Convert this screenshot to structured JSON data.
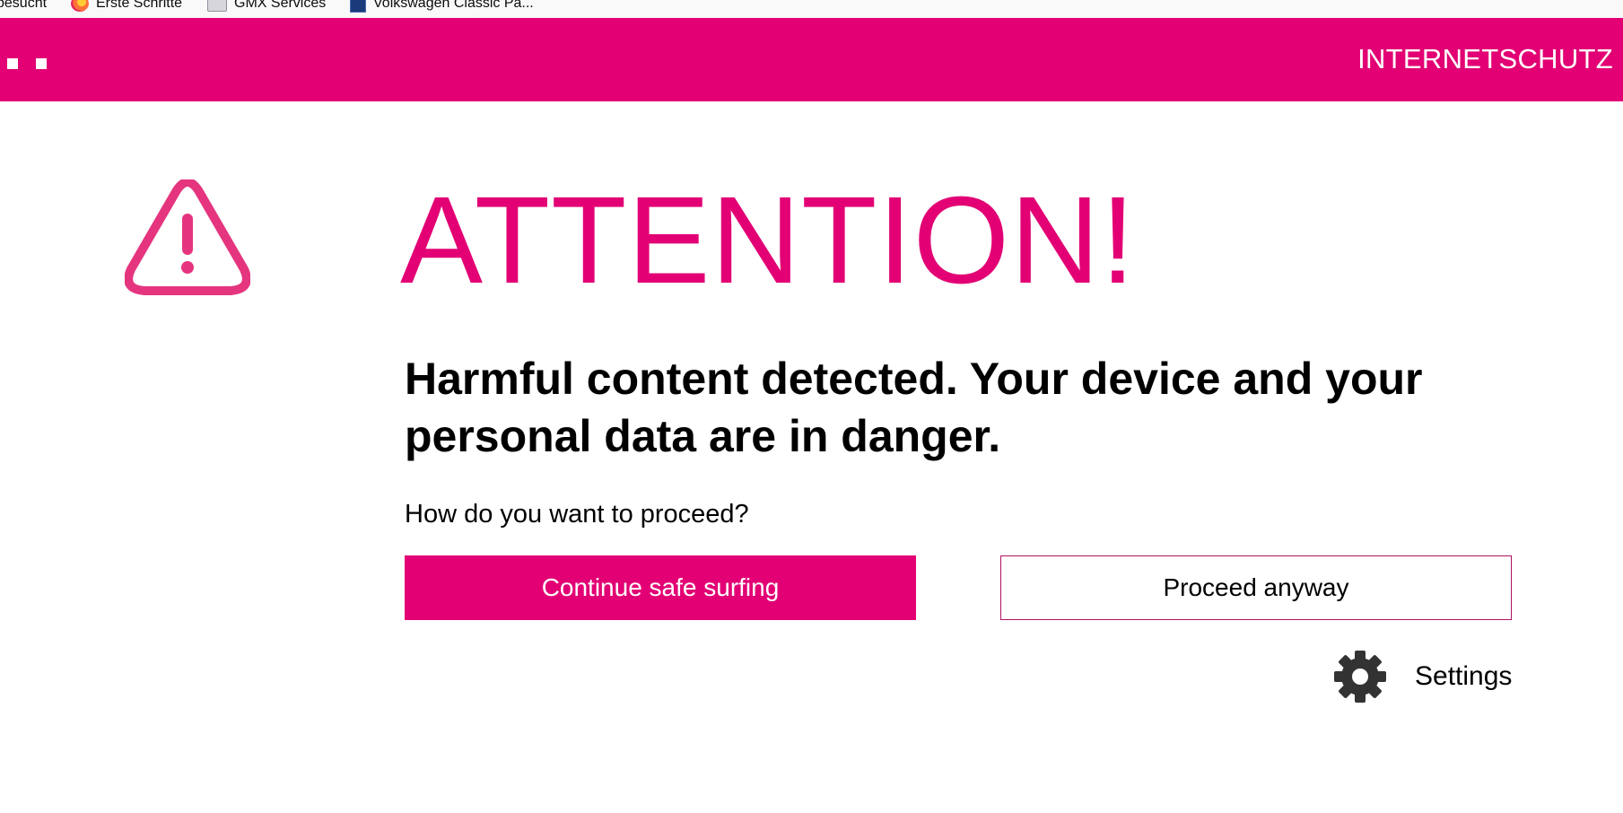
{
  "bookmarks": [
    {
      "label": "besucht",
      "icon": "none"
    },
    {
      "label": "Erste Schritte",
      "icon": "firefox-icon"
    },
    {
      "label": "GMX Services",
      "icon": "folder-icon"
    },
    {
      "label": "Volkswagen Classic Pa...",
      "icon": "volkswagen-icon"
    }
  ],
  "header": {
    "title": "INTERNETSCHUTZ",
    "background_color": "#e20074"
  },
  "warning": {
    "icon": "warning-triangle-icon",
    "headline": "ATTENTION!",
    "message": "Harmful content detected. Your device and your personal data are in danger.",
    "question": "How do you want to proceed?"
  },
  "actions": {
    "continue_label": "Continue safe surfing",
    "proceed_label": "Proceed anyway",
    "settings_label": "Settings",
    "settings_icon": "gear-icon"
  },
  "colors": {
    "brand_magenta": "#e20074",
    "icon_pink": "#e5357f",
    "gear_dark": "#333333"
  }
}
